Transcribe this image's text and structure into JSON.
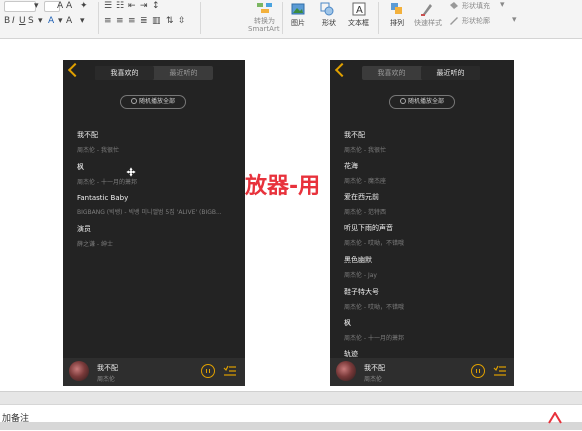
{
  "ribbon": {
    "font_name": "",
    "font_size": "",
    "convert_smartart_line1": "转换为",
    "convert_smartart_line2": "SmartArt",
    "picture_label": "图片",
    "shape_label": "形状",
    "textbox_label": "文本框",
    "arrange_label": "排列",
    "quick_styles_label": "快速样式",
    "shape_fill_label": "形状填充",
    "shape_outline_label": "形状轮廓"
  },
  "slide": {
    "title_fragment": "放器-用"
  },
  "left_phone": {
    "tabs": [
      "我喜欢的",
      "最近听的"
    ],
    "active_tab": 0,
    "shuffle_label": "随机播放全部",
    "songs": [
      {
        "title": "我不配",
        "artist": "周杰伦 - 我很忙"
      },
      {
        "title": "枫",
        "artist": "周杰伦 - 十一月的萧邦"
      },
      {
        "title": "Fantastic Baby",
        "artist": "BIGBANG (빅뱅) - 빅뱅 미니앨범 5집 'ALIVE' (BIGB..."
      },
      {
        "title": "演员",
        "artist": "薛之谦 - 绅士"
      }
    ],
    "now_playing": {
      "title": "我不配",
      "artist": "周杰伦"
    }
  },
  "right_phone": {
    "tabs": [
      "我喜欢的",
      "最近听的"
    ],
    "active_tab": 1,
    "shuffle_label": "随机播放全部",
    "songs": [
      {
        "title": "我不配",
        "artist": "周杰伦 - 我很忙"
      },
      {
        "title": "花海",
        "artist": "周杰伦 - 魔杰座"
      },
      {
        "title": "爱在西元前",
        "artist": "周杰伦 - 范特西"
      },
      {
        "title": "听见下雨的声音",
        "artist": "周杰伦 - 哎呦，不错哦"
      },
      {
        "title": "黑色幽默",
        "artist": "周杰伦 - Jay"
      },
      {
        "title": "鞋子特大号",
        "artist": "周杰伦 - 哎呦，不错哦"
      },
      {
        "title": "枫",
        "artist": "周杰伦 - 十一月的萧邦"
      },
      {
        "title": "轨迹",
        "artist": ""
      }
    ],
    "now_playing": {
      "title": "我不配",
      "artist": "周杰伦"
    }
  },
  "notes": {
    "placeholder": "加备注"
  },
  "colors": {
    "accent": "#e0a000",
    "title_red": "#e8323c",
    "phone_bg": "#232323"
  }
}
